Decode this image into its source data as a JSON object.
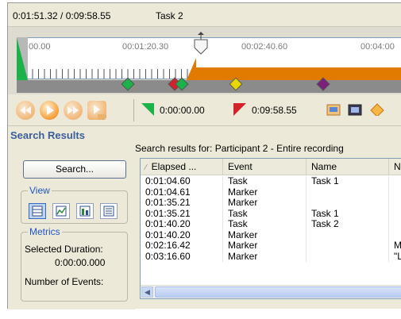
{
  "timebar": {
    "time": "0:01:51.32 / 0:09:58.55",
    "task": "Task 2"
  },
  "timeline": {
    "labels": [
      "00.00",
      "00:01:20.30",
      "00:02:40.60",
      "00:04:00"
    ],
    "colors": {
      "green": "#1cb24a",
      "red": "#d4212a",
      "yellow": "#e8d800",
      "purple": "#7b1f7b",
      "orange": "#e07b00"
    }
  },
  "toolbar": {
    "start_time": "0:00:00.00",
    "end_time": "0:09:58.55",
    "buttons": [
      "rewind-button",
      "play-button",
      "fast-forward-button",
      "step-button"
    ]
  },
  "left": {
    "title": "Search Results",
    "search_label": "Search...",
    "view_legend": "View",
    "metrics_legend": "Metrics",
    "selected_duration_label": "Selected Duration:",
    "selected_duration_value": "0:00:00.000",
    "number_events_label": "Number of Events:"
  },
  "results": {
    "label": "Search results for: Participant 2 - Entire recording",
    "columns": [
      "Elapsed ...",
      "Event",
      "Name",
      "No"
    ],
    "rows": [
      [
        "0:01:04.60",
        "Task",
        "Task 1",
        ""
      ],
      [
        "0:01:04.61",
        "Marker",
        "",
        ""
      ],
      [
        "0:01:35.21",
        "Marker",
        "",
        ""
      ],
      [
        "0:01:35.21",
        "Task",
        "Task 1",
        ""
      ],
      [
        "0:01:40.20",
        "Task",
        "Task 2",
        ""
      ],
      [
        "0:01:40.20",
        "Marker",
        "",
        ""
      ],
      [
        "0:02:16.42",
        "Marker",
        "",
        "Mis"
      ],
      [
        "0:03:16.60",
        "Marker",
        "",
        "\"Lo"
      ]
    ]
  }
}
